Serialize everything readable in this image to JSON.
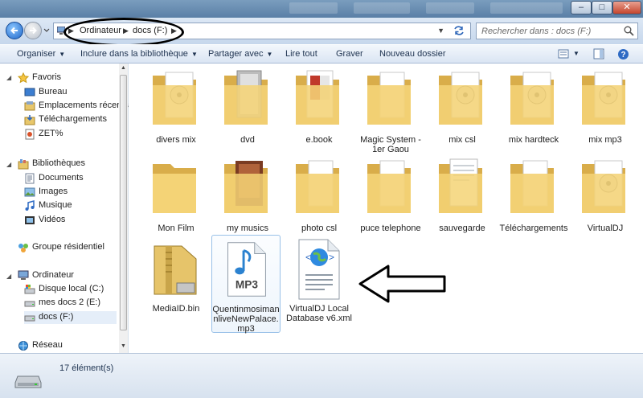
{
  "address": {
    "crumbs": [
      "Ordinateur",
      "docs (F:)"
    ],
    "search_placeholder": "Rechercher dans : docs (F:)"
  },
  "commands": {
    "organize": "Organiser",
    "include": "Inclure dans la bibliothèque",
    "share": "Partager avec",
    "play": "Lire tout",
    "burn": "Graver",
    "new_folder": "Nouveau dossier"
  },
  "nav": {
    "favorites": "Favoris",
    "desktop": "Bureau",
    "recent": "Emplacements récents",
    "downloads": "Téléchargements",
    "zet": "ZET%",
    "libraries": "Bibliothèques",
    "documents": "Documents",
    "images": "Images",
    "music": "Musique",
    "videos": "Vidéos",
    "homegroup": "Groupe résidentiel",
    "computer": "Ordinateur",
    "drive_c": "Disque local (C:)",
    "drive_e": "mes docs 2 (E:)",
    "drive_f": "docs (F:)",
    "network": "Réseau"
  },
  "files": [
    {
      "name": "divers mix",
      "icon": "folder-media-icon"
    },
    {
      "name": "dvd",
      "icon": "folder-icon"
    },
    {
      "name": "e.book",
      "icon": "folder-doc-icon"
    },
    {
      "name": "Magic System - 1er Gaou",
      "icon": "folder-icon"
    },
    {
      "name": "mix csl",
      "icon": "folder-media-icon"
    },
    {
      "name": "mix hardteck",
      "icon": "folder-media-icon"
    },
    {
      "name": "mix mp3",
      "icon": "folder-media-icon"
    },
    {
      "name": "Mon Film",
      "icon": "folder-icon"
    },
    {
      "name": "my musics",
      "icon": "folder-photo-icon"
    },
    {
      "name": "photo csl",
      "icon": "folder-icon"
    },
    {
      "name": "puce telephone",
      "icon": "folder-icon"
    },
    {
      "name": "sauvegarde",
      "icon": "folder-doc-icon"
    },
    {
      "name": "Téléchargements",
      "icon": "folder-icon"
    },
    {
      "name": "VirtualDJ",
      "icon": "folder-media-icon"
    },
    {
      "name": "MediaID.bin",
      "icon": "zip-file-icon"
    },
    {
      "name": "QuentinmosimanniveNewPalace.mp3",
      "display": "Quentinmosiman nliveNewPalace. mp3",
      "icon": "mp3-file-icon"
    },
    {
      "name": "VirtualDJ Local Database v6.xml",
      "icon": "xml-file-icon"
    }
  ],
  "status": {
    "count": "17 élément(s)"
  }
}
